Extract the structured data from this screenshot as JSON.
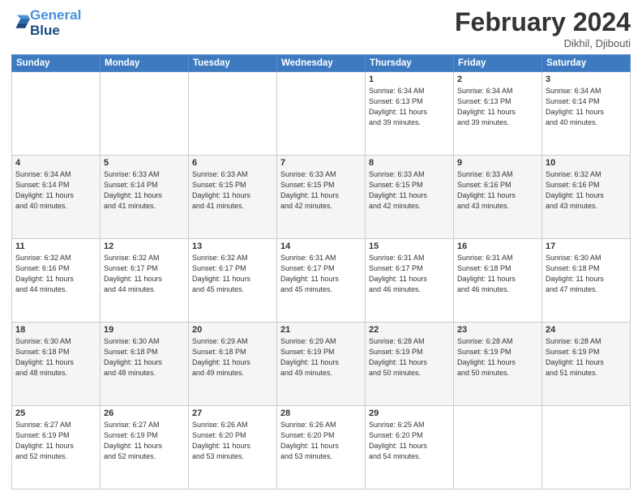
{
  "header": {
    "logo_line1": "General",
    "logo_line2": "Blue",
    "title": "February 2024",
    "subtitle": "Dikhil, Djibouti"
  },
  "days_of_week": [
    "Sunday",
    "Monday",
    "Tuesday",
    "Wednesday",
    "Thursday",
    "Friday",
    "Saturday"
  ],
  "weeks": [
    [
      {
        "num": "",
        "info": ""
      },
      {
        "num": "",
        "info": ""
      },
      {
        "num": "",
        "info": ""
      },
      {
        "num": "",
        "info": ""
      },
      {
        "num": "1",
        "info": "Sunrise: 6:34 AM\nSunset: 6:13 PM\nDaylight: 11 hours\nand 39 minutes."
      },
      {
        "num": "2",
        "info": "Sunrise: 6:34 AM\nSunset: 6:13 PM\nDaylight: 11 hours\nand 39 minutes."
      },
      {
        "num": "3",
        "info": "Sunrise: 6:34 AM\nSunset: 6:14 PM\nDaylight: 11 hours\nand 40 minutes."
      }
    ],
    [
      {
        "num": "4",
        "info": "Sunrise: 6:34 AM\nSunset: 6:14 PM\nDaylight: 11 hours\nand 40 minutes."
      },
      {
        "num": "5",
        "info": "Sunrise: 6:33 AM\nSunset: 6:14 PM\nDaylight: 11 hours\nand 41 minutes."
      },
      {
        "num": "6",
        "info": "Sunrise: 6:33 AM\nSunset: 6:15 PM\nDaylight: 11 hours\nand 41 minutes."
      },
      {
        "num": "7",
        "info": "Sunrise: 6:33 AM\nSunset: 6:15 PM\nDaylight: 11 hours\nand 42 minutes."
      },
      {
        "num": "8",
        "info": "Sunrise: 6:33 AM\nSunset: 6:15 PM\nDaylight: 11 hours\nand 42 minutes."
      },
      {
        "num": "9",
        "info": "Sunrise: 6:33 AM\nSunset: 6:16 PM\nDaylight: 11 hours\nand 43 minutes."
      },
      {
        "num": "10",
        "info": "Sunrise: 6:32 AM\nSunset: 6:16 PM\nDaylight: 11 hours\nand 43 minutes."
      }
    ],
    [
      {
        "num": "11",
        "info": "Sunrise: 6:32 AM\nSunset: 6:16 PM\nDaylight: 11 hours\nand 44 minutes."
      },
      {
        "num": "12",
        "info": "Sunrise: 6:32 AM\nSunset: 6:17 PM\nDaylight: 11 hours\nand 44 minutes."
      },
      {
        "num": "13",
        "info": "Sunrise: 6:32 AM\nSunset: 6:17 PM\nDaylight: 11 hours\nand 45 minutes."
      },
      {
        "num": "14",
        "info": "Sunrise: 6:31 AM\nSunset: 6:17 PM\nDaylight: 11 hours\nand 45 minutes."
      },
      {
        "num": "15",
        "info": "Sunrise: 6:31 AM\nSunset: 6:17 PM\nDaylight: 11 hours\nand 46 minutes."
      },
      {
        "num": "16",
        "info": "Sunrise: 6:31 AM\nSunset: 6:18 PM\nDaylight: 11 hours\nand 46 minutes."
      },
      {
        "num": "17",
        "info": "Sunrise: 6:30 AM\nSunset: 6:18 PM\nDaylight: 11 hours\nand 47 minutes."
      }
    ],
    [
      {
        "num": "18",
        "info": "Sunrise: 6:30 AM\nSunset: 6:18 PM\nDaylight: 11 hours\nand 48 minutes."
      },
      {
        "num": "19",
        "info": "Sunrise: 6:30 AM\nSunset: 6:18 PM\nDaylight: 11 hours\nand 48 minutes."
      },
      {
        "num": "20",
        "info": "Sunrise: 6:29 AM\nSunset: 6:18 PM\nDaylight: 11 hours\nand 49 minutes."
      },
      {
        "num": "21",
        "info": "Sunrise: 6:29 AM\nSunset: 6:19 PM\nDaylight: 11 hours\nand 49 minutes."
      },
      {
        "num": "22",
        "info": "Sunrise: 6:28 AM\nSunset: 6:19 PM\nDaylight: 11 hours\nand 50 minutes."
      },
      {
        "num": "23",
        "info": "Sunrise: 6:28 AM\nSunset: 6:19 PM\nDaylight: 11 hours\nand 50 minutes."
      },
      {
        "num": "24",
        "info": "Sunrise: 6:28 AM\nSunset: 6:19 PM\nDaylight: 11 hours\nand 51 minutes."
      }
    ],
    [
      {
        "num": "25",
        "info": "Sunrise: 6:27 AM\nSunset: 6:19 PM\nDaylight: 11 hours\nand 52 minutes."
      },
      {
        "num": "26",
        "info": "Sunrise: 6:27 AM\nSunset: 6:19 PM\nDaylight: 11 hours\nand 52 minutes."
      },
      {
        "num": "27",
        "info": "Sunrise: 6:26 AM\nSunset: 6:20 PM\nDaylight: 11 hours\nand 53 minutes."
      },
      {
        "num": "28",
        "info": "Sunrise: 6:26 AM\nSunset: 6:20 PM\nDaylight: 11 hours\nand 53 minutes."
      },
      {
        "num": "29",
        "info": "Sunrise: 6:25 AM\nSunset: 6:20 PM\nDaylight: 11 hours\nand 54 minutes."
      },
      {
        "num": "",
        "info": ""
      },
      {
        "num": "",
        "info": ""
      }
    ]
  ]
}
